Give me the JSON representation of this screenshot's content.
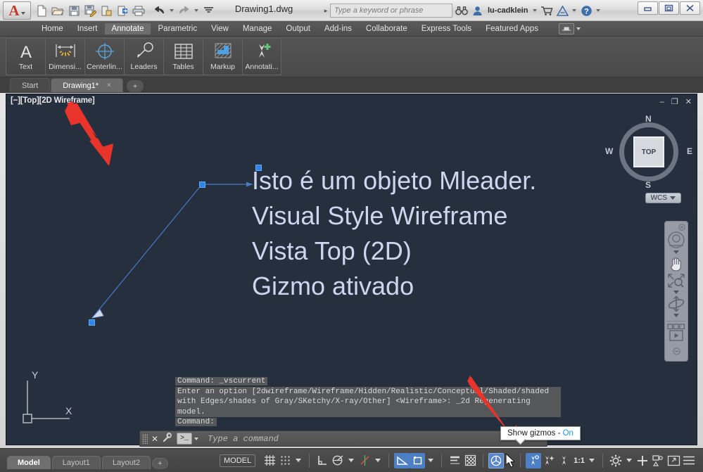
{
  "titlebar": {
    "app_menu": "A",
    "document_title": "Drawing1.dwg",
    "quick_access": [
      {
        "name": "new-icon",
        "label": "New"
      },
      {
        "name": "open-icon",
        "label": "Open"
      },
      {
        "name": "save-icon",
        "label": "Save"
      },
      {
        "name": "save-as-icon",
        "label": "Save As"
      },
      {
        "name": "plot-preview-icon",
        "label": "Plot Preview"
      },
      {
        "name": "publish-icon",
        "label": "Publish"
      },
      {
        "name": "print-icon",
        "label": "Plot"
      },
      {
        "name": "undo-icon",
        "label": "Undo"
      },
      {
        "name": "redo-icon",
        "label": "Redo"
      },
      {
        "name": "customize-qat-icon",
        "label": "Customize Quick Access Toolbar"
      }
    ],
    "search_placeholder": "Type a keyword or phrase",
    "search_icon": "binoculars-icon",
    "user_icon": "person-icon",
    "user_name": "lu-cadklein",
    "cart_icon": "shopping-cart-icon",
    "autodesk_icon": "autodesk-a-icon",
    "help_icon": "question-mark-icon",
    "window_controls": [
      {
        "name": "minimize-button",
        "glyph": "–"
      },
      {
        "name": "restore-button",
        "glyph": "▣"
      },
      {
        "name": "close-button",
        "glyph": "✖"
      }
    ]
  },
  "ribbon": {
    "tabs": [
      {
        "label": "Home",
        "active": false
      },
      {
        "label": "Insert",
        "active": false
      },
      {
        "label": "Annotate",
        "active": true
      },
      {
        "label": "Parametric",
        "active": false
      },
      {
        "label": "View",
        "active": false
      },
      {
        "label": "Manage",
        "active": false
      },
      {
        "label": "Output",
        "active": false
      },
      {
        "label": "Add-ins",
        "active": false
      },
      {
        "label": "Collaborate",
        "active": false
      },
      {
        "label": "Express Tools",
        "active": false
      },
      {
        "label": "Featured Apps",
        "active": false
      }
    ],
    "hardware_icon": "hardware-acceleration-icon",
    "panel_buttons": [
      {
        "label": "Text",
        "icon": "text-a-icon"
      },
      {
        "label": "Dimensi...",
        "icon": "dimension-icon"
      },
      {
        "label": "Centerlin...",
        "icon": "centerline-icon"
      },
      {
        "label": "Leaders",
        "icon": "leader-icon"
      },
      {
        "label": "Tables",
        "icon": "table-grid-icon"
      },
      {
        "label": "Markup",
        "icon": "markup-hatch-icon"
      },
      {
        "label": "Annotati...",
        "icon": "annotation-scaling-icon"
      }
    ]
  },
  "file_tabs": [
    {
      "label": "Start",
      "active": false,
      "closable": false
    },
    {
      "label": "Drawing1*",
      "active": true,
      "closable": true,
      "close_glyph": "×"
    },
    {
      "label": "+",
      "active": false,
      "closable": false
    }
  ],
  "viewport": {
    "label": "[−][Top][2D Wireframe]",
    "controls": [
      {
        "name": "viewport-minimize-button",
        "glyph": "–"
      },
      {
        "name": "viewport-restore-button",
        "glyph": "❐"
      },
      {
        "name": "viewport-close-button",
        "glyph": "✕"
      }
    ],
    "mleader_text": [
      "Isto é um objeto Mleader.",
      "Visual Style Wireframe",
      "Vista Top (2D)",
      "Gizmo ativado"
    ],
    "viewcube": {
      "face": "TOP",
      "north": "N",
      "south": "S",
      "west": "W",
      "east": "E",
      "ucs_label": "WCS"
    },
    "navbar_items": [
      {
        "name": "steering-wheel-icon"
      },
      {
        "name": "pan-hand-icon"
      },
      {
        "name": "zoom-magnifier-icon"
      },
      {
        "name": "orbit-icon"
      },
      {
        "name": "showmotion-icon"
      }
    ],
    "ucs_icon": {
      "x_label": "X",
      "y_label": "Y"
    }
  },
  "command_window": {
    "history": [
      "Command: _vscurrent",
      "Enter an option [2dwireframe/Wireframe/Hidden/Realistic/Conceptual/Shaded/shaded",
      "with Edges/shades of Gray/SKetchy/X-ray/Other] <Wireframe>: _2d Regenerating",
      "model.",
      "Command:"
    ],
    "prompt_glyph": ">_",
    "input_placeholder": "Type a command",
    "close_glyph": "✕",
    "wrench_icon": "wrench-icon"
  },
  "tooltip": {
    "text": "Show gizmos - ",
    "value": "On"
  },
  "statusbar": {
    "layout_tabs": [
      {
        "label": "Model",
        "active": true
      },
      {
        "label": "Layout1",
        "active": false
      },
      {
        "label": "Layout2",
        "active": false
      },
      {
        "label": "+",
        "active": false
      }
    ],
    "model_button": "MODEL",
    "scale": "1:1",
    "buttons": [
      {
        "name": "grid-display-button",
        "icon": "grid-icon",
        "state": "off"
      },
      {
        "name": "snap-mode-button",
        "icon": "snap-dots-icon",
        "state": "off"
      },
      {
        "name": "infer-constraints-button",
        "icon": "infer-constraints-icon",
        "state": "off"
      },
      {
        "name": "dynamic-ucs-button",
        "icon": "dynamic-ucs-icon",
        "state": "off"
      },
      {
        "name": "object-snap-button",
        "icon": "osnap-icon",
        "state": "off"
      },
      {
        "name": "ortho-mode-button",
        "icon": "ortho-angle-icon",
        "state": "on"
      },
      {
        "name": "polar-tracking-button",
        "icon": "polar-square-icon",
        "state": "on"
      },
      {
        "name": "lineweight-button",
        "icon": "lineweight-icon",
        "state": "off"
      },
      {
        "name": "transparency-button",
        "icon": "transparency-checker-icon",
        "state": "off"
      },
      {
        "name": "show-gizmos-button",
        "icon": "gizmo-icon",
        "state": "highlight"
      },
      {
        "name": "annotation-visibility-button",
        "icon": "annotation-visibility-icon",
        "state": "on"
      },
      {
        "name": "autoscale-button",
        "icon": "autoscale-icon",
        "state": "off"
      },
      {
        "name": "annotation-scale-button",
        "icon": "annotation-scale-icon",
        "state": "off"
      },
      {
        "name": "workspace-settings-button",
        "icon": "gear-icon",
        "state": "off"
      },
      {
        "name": "isolate-objects-button",
        "icon": "plus-icon",
        "state": "off"
      },
      {
        "name": "hardware-accel-button",
        "icon": "hardware-accel-icon",
        "state": "off"
      },
      {
        "name": "clean-screen-button",
        "icon": "clean-screen-icon",
        "state": "off"
      },
      {
        "name": "customization-button",
        "icon": "hamburger-icon",
        "state": "off"
      }
    ]
  },
  "colors": {
    "canvas_bg": "#262f3d",
    "mleader_text": "#ccd6ef",
    "grip_blue": "#2f85e8",
    "accent_blue": "#4d7fc4",
    "red_arrow": "#e8342a",
    "tooltip_on": "#1f9ae0"
  }
}
